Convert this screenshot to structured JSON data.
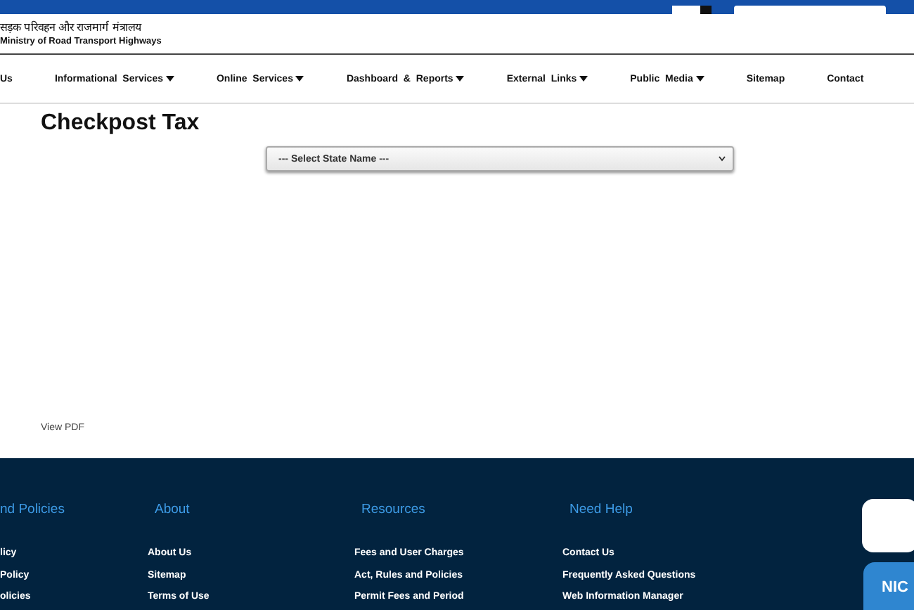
{
  "header": {
    "hindi_title": "सड़क परिवहन और राजमार्ग मंत्रालय",
    "title": "Ministry of Road Transport Highways"
  },
  "nav": [
    {
      "label": "Us",
      "dropdown": false
    },
    {
      "label": "Informational  Services",
      "dropdown": true
    },
    {
      "label": "Online  Services",
      "dropdown": true
    },
    {
      "label": "Dashboard  &  Reports",
      "dropdown": true
    },
    {
      "label": "External  Links",
      "dropdown": true
    },
    {
      "label": "Public  Media",
      "dropdown": true
    },
    {
      "label": "Sitemap",
      "dropdown": false
    },
    {
      "label": "Contact",
      "dropdown": false
    }
  ],
  "page": {
    "title": "Checkpost Tax",
    "state_select": {
      "value": "--- Select State Name ---"
    },
    "view_pdf": "View PDF"
  },
  "footer": {
    "columns": [
      {
        "heading": "nd Policies",
        "links": [
          "licy",
          "Policy",
          "olicies"
        ]
      },
      {
        "heading": "About",
        "links": [
          "About Us",
          "Sitemap",
          "Terms of Use"
        ]
      },
      {
        "heading": "Resources",
        "links": [
          "Fees and User Charges",
          "Act, Rules and Policies",
          "Permit Fees and Period"
        ]
      },
      {
        "heading": "Need Help",
        "links": [
          "Contact Us",
          "Frequently Asked Questions",
          "Web Information Manager"
        ]
      }
    ],
    "badge": "NIC"
  }
}
